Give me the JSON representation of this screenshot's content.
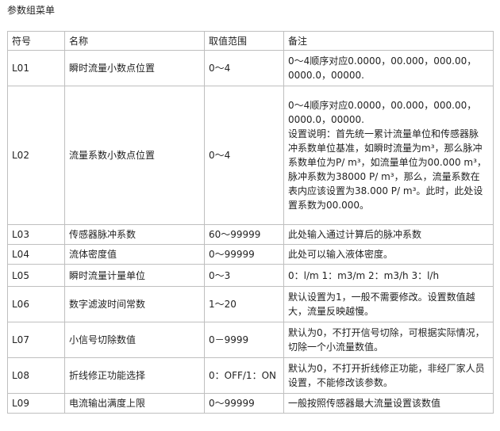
{
  "title": "参数组菜单",
  "headers": [
    "符号",
    "名称",
    "取值范围",
    "备注"
  ],
  "rows": [
    {
      "code": "L01",
      "name": "瞬时流量小数点位置",
      "range": "0～4",
      "note_lines": [
        "0～4顺序对应0.0000，00.000，000.00，",
        "0000.0，00000."
      ]
    },
    {
      "code": "L02",
      "name": "流量系数小数点位置",
      "range": "0～4",
      "note_lines": [
        "0～4顺序对应0.0000，00.000，000.00，",
        "0000.0，00000.",
        "设置说明：首先统一累计流量单位和传感器脉",
        "冲系数单位基准，如瞬时流量为m³，那么脉冲",
        "系数单位为P/ m³，如流量单位为00.000 m³，",
        "脉冲系数为38000 P/ m³，那么，流量系数在",
        "表内应该设置为38.000 P/ m³。此时，此处设",
        "置系数为00.000。"
      ]
    },
    {
      "code": "L03",
      "name": "传感器脉冲系数",
      "range": "60～99999",
      "note_lines": [
        "此处输入通过计算后的脉冲系数"
      ]
    },
    {
      "code": "L04",
      "name": "流体密度值",
      "range": "0～99999",
      "note_lines": [
        "此处可以输入液体密度。"
      ]
    },
    {
      "code": "L05",
      "name": "瞬时流量计量单位",
      "range": "0～3",
      "note_lines": [
        "0：l/m 1：m3/m 2：m3/h 3：l/h"
      ]
    },
    {
      "code": "L06",
      "name": "数字滤波时间常数",
      "range": "1～20",
      "note_lines": [
        "默认设置为1，一般不需要修改。设置数值越",
        "大，流量反映越慢。"
      ]
    },
    {
      "code": "L07",
      "name": "小信号切除数值",
      "range": "0－9999",
      "note_lines": [
        "默认为0，不打开信号切除，可根据实际情况，",
        "切除一个小流量数值。"
      ]
    },
    {
      "code": "L08",
      "name": "折线修正功能选择",
      "range": "0：OFF/1：ON",
      "note_lines": [
        "默认为0，不打开折线修正功能，非经厂家人员",
        "设置，不能修改该参数。"
      ]
    },
    {
      "code": "L09",
      "name": "电流输出满度上限",
      "range": "0～99999",
      "note_lines": [
        "一般按照传感器最大流量设置该数值"
      ]
    }
  ]
}
